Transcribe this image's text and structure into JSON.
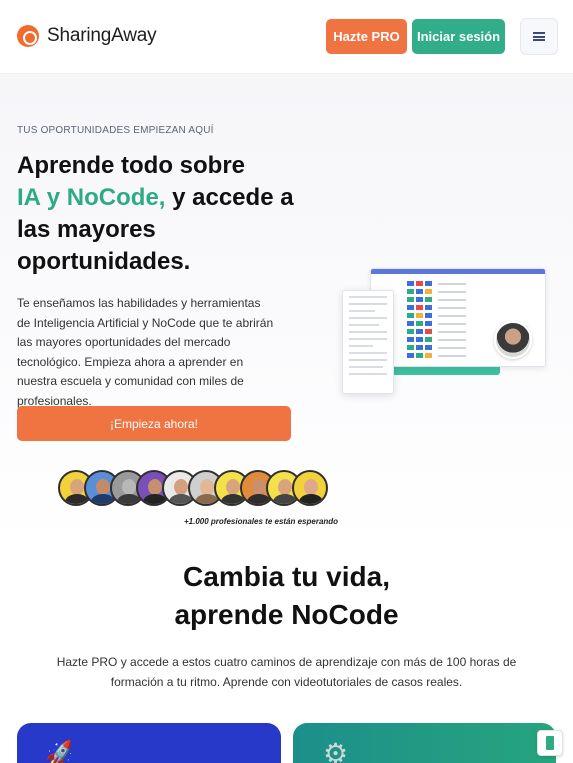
{
  "header": {
    "brand": "SharingAway",
    "pro_label": "Hazte PRO",
    "login_label": "Iniciar sesión",
    "menu_icon": "hamburger-icon"
  },
  "hero": {
    "eyebrow": "TUS OPORTUNIDADES EMPIEZAN AQUÍ",
    "headline_part1": "Aprende todo sobre",
    "headline_accent": "IA y NoCode,",
    "headline_part2": "y accede a las mayores oportunidades.",
    "description": "Te enseñamos las habilidades y herramientas de Inteligencia Artificial y NoCode que te abrirán las mayores oportunidades del mercado tecnológico. Empieza ahora a aprender en nuestra escuela y comunidad con miles de profesionales.",
    "cta_label": "¡Empieza ahora!",
    "waiting_text": "+1.000 profesionales te están esperando"
  },
  "section": {
    "title_line1": "Cambia tu vida,",
    "title_line2": "aprende NoCode",
    "description": "Hazte PRO y accede a estos cuatro caminos de aprendizaje con más de 100 horas de formación a tu ritmo. Aprende con videotutoriales de casos reales."
  },
  "cards": [
    {
      "icon": "rocket-icon",
      "color": "#2739c9"
    },
    {
      "icon": "gear-icon",
      "color": "#1c8f8a"
    }
  ],
  "colors": {
    "accent_orange": "#f07442",
    "accent_green": "#31ad8a",
    "headline_green": "#2eaa84"
  }
}
